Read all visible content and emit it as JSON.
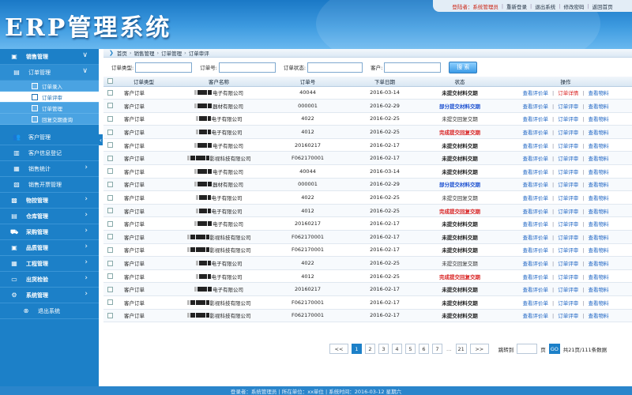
{
  "app": {
    "logo": "ERP管理系统"
  },
  "toplinks": {
    "user": "登陆者：系统管理员",
    "items": [
      "重新登录",
      "退出系统",
      "修改密码",
      "返回首页"
    ]
  },
  "sidebar": {
    "sales": "销售管理",
    "order_mgmt": "订单管理",
    "order_items": [
      "订单录入",
      "订单评审",
      "订单管理",
      "回复交期查询"
    ],
    "customer_mgmt": "客户管理",
    "customer_info": "客户信息登记",
    "sales_stats": "销售统计",
    "sales_invoice": "销售开票管理",
    "modules": [
      "物控管理",
      "仓库管理",
      "采购管理",
      "品质管理",
      "工程管理",
      "出货检验",
      "系统管理"
    ],
    "logout": "退出系统"
  },
  "breadcrumb": [
    "首页",
    "销售管理",
    "订单管理",
    "订单审评"
  ],
  "filter": {
    "type_label": "订单类型:",
    "no_label": "订单号:",
    "status_label": "订单状态:",
    "customer_label": "客户:",
    "search_label": "搜 索"
  },
  "table": {
    "headers": [
      "订单类型",
      "客户名称",
      "订单号",
      "下单日期",
      "状态",
      "操作"
    ],
    "ops": [
      "查看评价单",
      "订单评审",
      "查看物料"
    ],
    "ops_first_row_mid": "订单详情",
    "rows": [
      {
        "type": "客户订单",
        "cust": "电子有限公司",
        "no": "40044",
        "date": "2016-03-14",
        "status": "未提交材料交期",
        "st": "dark"
      },
      {
        "type": "客户订单",
        "cust": "器材有限公司",
        "no": "000001",
        "date": "2016-02-29",
        "status": "部分提交材料交期",
        "st": "blue"
      },
      {
        "type": "客户订单",
        "cust": "电子有限公司",
        "no": "4022",
        "date": "2016-02-25",
        "status": "未提交回复交期",
        "st": "gray"
      },
      {
        "type": "客户订单",
        "cust": "电子有限公司",
        "no": "4012",
        "date": "2016-02-25",
        "status": "完成提交回复交期",
        "st": "red"
      },
      {
        "type": "客户订单",
        "cust": "电子有限公司",
        "no": "20160217",
        "date": "2016-02-17",
        "status": "未提交材料交期",
        "st": "dark"
      },
      {
        "type": "客户订单",
        "cust": "影视科技有限公司",
        "no": "F062170001",
        "date": "2016-02-17",
        "status": "未提交材料交期",
        "st": "dark"
      },
      {
        "type": "客户订单",
        "cust": "电子有限公司",
        "no": "40044",
        "date": "2016-03-14",
        "status": "未提交材料交期",
        "st": "dark"
      },
      {
        "type": "客户订单",
        "cust": "器材有限公司",
        "no": "000001",
        "date": "2016-02-29",
        "status": "部分提交材料交期",
        "st": "blue"
      },
      {
        "type": "客户订单",
        "cust": "电子有限公司",
        "no": "4022",
        "date": "2016-02-25",
        "status": "未提交回复交期",
        "st": "gray"
      },
      {
        "type": "客户订单",
        "cust": "电子有限公司",
        "no": "4012",
        "date": "2016-02-25",
        "status": "完成提交回复交期",
        "st": "red"
      },
      {
        "type": "客户订单",
        "cust": "电子有限公司",
        "no": "20160217",
        "date": "2016-02-17",
        "status": "未提交材料交期",
        "st": "dark"
      },
      {
        "type": "客户订单",
        "cust": "影视科技有限公司",
        "no": "F062170001",
        "date": "2016-02-17",
        "status": "未提交材料交期",
        "st": "dark"
      },
      {
        "type": "客户订单",
        "cust": "影视科技有限公司",
        "no": "F062170001",
        "date": "2016-02-17",
        "status": "未提交材料交期",
        "st": "dark"
      },
      {
        "type": "客户订单",
        "cust": "电子有限公司",
        "no": "4022",
        "date": "2016-02-25",
        "status": "未提交回复交期",
        "st": "gray"
      },
      {
        "type": "客户订单",
        "cust": "电子有限公司",
        "no": "4012",
        "date": "2016-02-25",
        "status": "完成提交回复交期",
        "st": "red"
      },
      {
        "type": "客户订单",
        "cust": "电子有限公司",
        "no": "20160217",
        "date": "2016-02-17",
        "status": "未提交材料交期",
        "st": "dark"
      },
      {
        "type": "客户订单",
        "cust": "影视科技有限公司",
        "no": "F062170001",
        "date": "2016-02-17",
        "status": "未提交材料交期",
        "st": "dark"
      },
      {
        "type": "客户订单",
        "cust": "影视科技有限公司",
        "no": "F062170001",
        "date": "2016-02-17",
        "status": "未提交材料交期",
        "st": "dark"
      }
    ]
  },
  "pager": {
    "prev": "<<",
    "pages": [
      "1",
      "2",
      "3",
      "4",
      "5",
      "6",
      "7"
    ],
    "dots": "…",
    "last": "21",
    "next": ">>",
    "jump_label": "跳转到",
    "page_unit": "页",
    "go": "GO",
    "summary": "共21页/111条数据",
    "current": 1
  },
  "footer": "登录者：系统管理员 | 所在单位：xx单位 | 系统时间：2016-03-12 星期六",
  "colors": {
    "accent": "#1c80c8",
    "red": "#d81e1e",
    "blue": "#1a4fd0"
  }
}
